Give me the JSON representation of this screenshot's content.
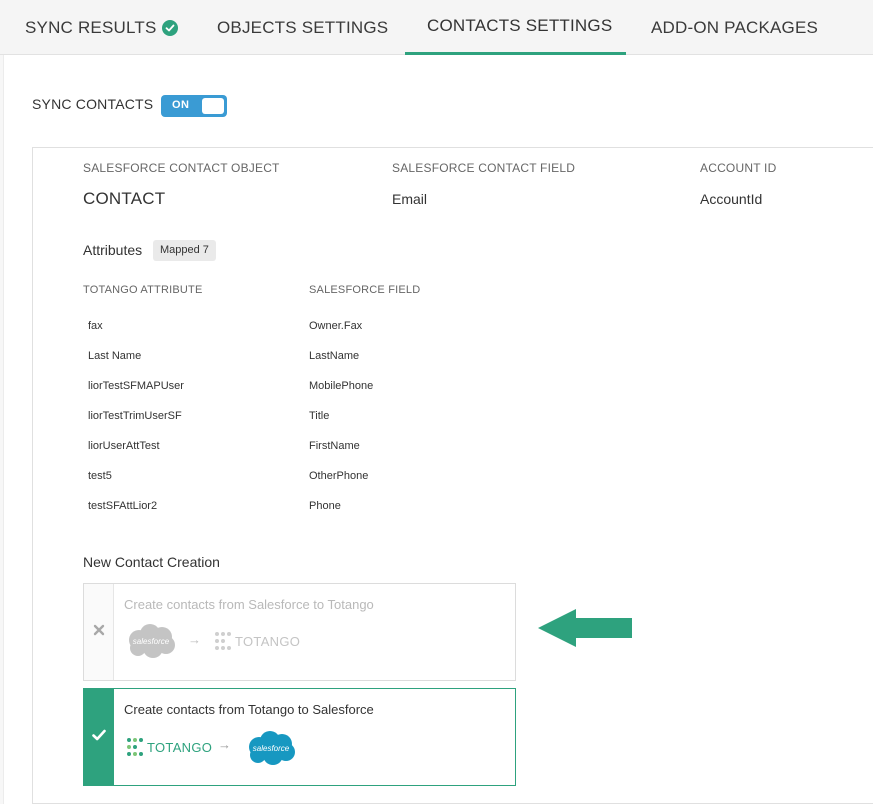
{
  "tabs": [
    {
      "label": "SYNC RESULTS",
      "has_check": true
    },
    {
      "label": "OBJECTS SETTINGS"
    },
    {
      "label": "CONTACTS SETTINGS",
      "active": true
    },
    {
      "label": "ADD-ON PACKAGES"
    }
  ],
  "sync": {
    "label": "SYNC CONTACTS",
    "toggle": "ON"
  },
  "contact_object": {
    "headers": [
      "SALESFORCE CONTACT OBJECT",
      "SALESFORCE CONTACT FIELD",
      "ACCOUNT ID"
    ],
    "values": [
      "CONTACT",
      "Email",
      "AccountId"
    ]
  },
  "attributes": {
    "title": "Attributes",
    "badge": "Mapped 7",
    "columns": [
      "TOTANGO ATTRIBUTE",
      "SALESFORCE FIELD"
    ],
    "rows": [
      [
        "fax",
        "Owner.Fax"
      ],
      [
        "Last Name",
        "LastName"
      ],
      [
        "liorTestSFMAPUser",
        "MobilePhone"
      ],
      [
        "liorTestTrimUserSF",
        "Title"
      ],
      [
        "liorUserAttTest",
        "FirstName"
      ],
      [
        "test5",
        "OtherPhone"
      ],
      [
        "testSFAttLior2",
        "Phone"
      ]
    ]
  },
  "new_contact": {
    "title": "New Contact Creation",
    "options": [
      {
        "label": "Create contacts from Salesforce to Totango",
        "selected": false,
        "from": "salesforce",
        "to": "TOTANGO"
      },
      {
        "label": "Create contacts from Totango to Salesforce",
        "selected": true,
        "from": "TOTANGO",
        "to": "salesforce"
      }
    ]
  },
  "colors": {
    "accent": "#2ea27e",
    "toggle": "#3a9bd4",
    "salesforce_blue": "#1798c1"
  },
  "icons": {
    "tab_check": "check-circle-icon",
    "option_off": "x-icon",
    "option_on": "check-icon",
    "callout": "arrow-left-icon"
  }
}
